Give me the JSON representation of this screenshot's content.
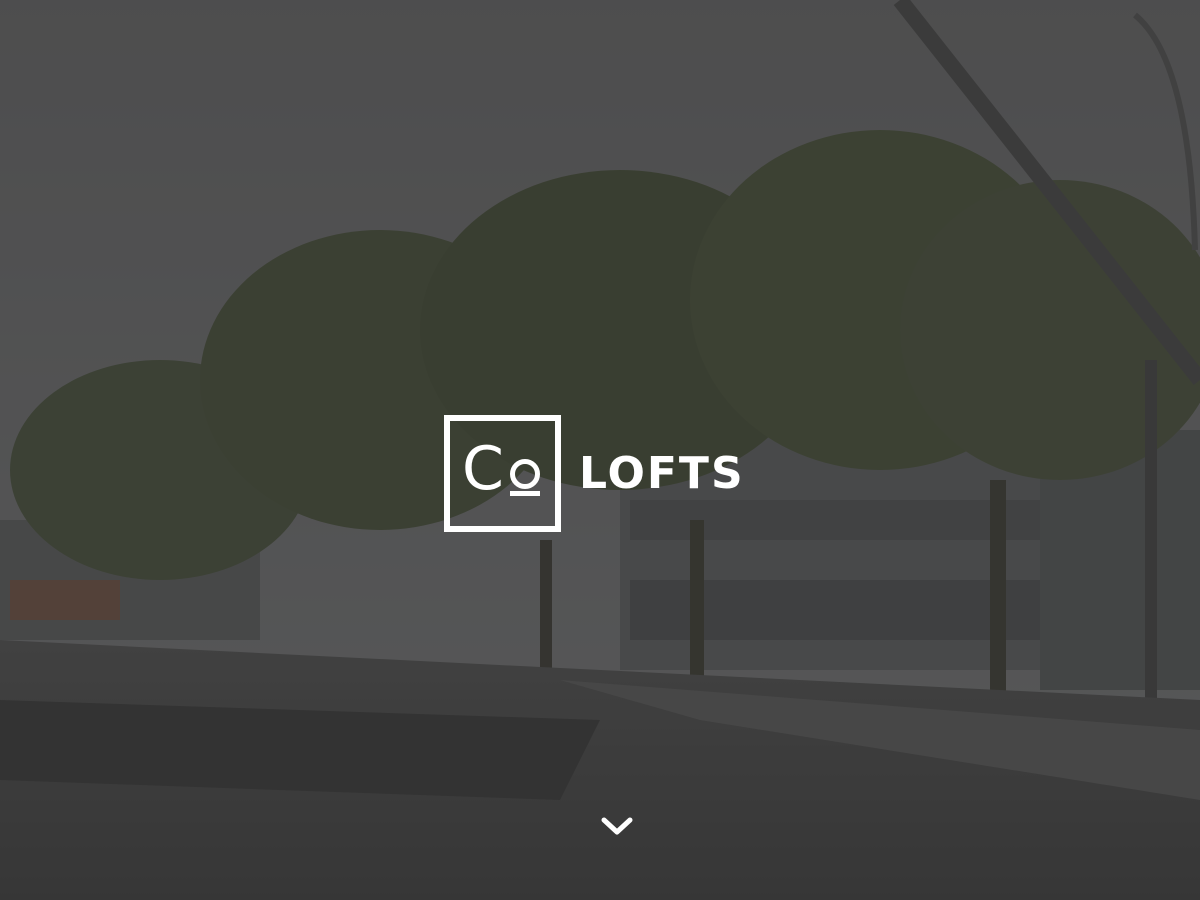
{
  "brand": {
    "mark_letter": "C",
    "name": "LOFTS"
  },
  "hero": {
    "overlay_color": "#282828",
    "scroll_icon": "chevron-down-icon"
  },
  "colors": {
    "text": "#ffffff"
  }
}
